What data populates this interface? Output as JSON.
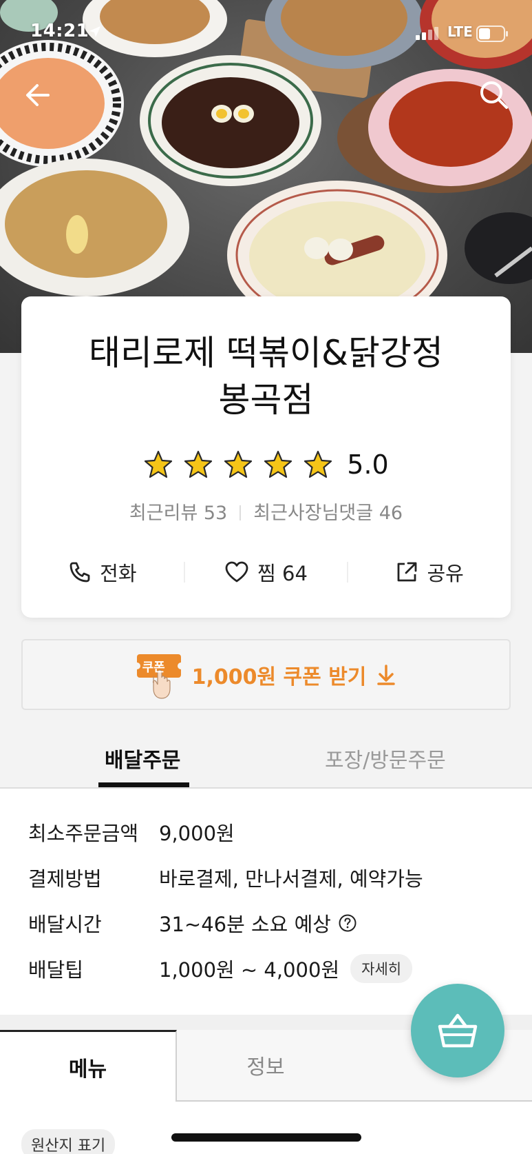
{
  "status_bar": {
    "time": "14:21",
    "network": "LTE"
  },
  "store": {
    "name_line1": "태리로제 떡볶이&닭강정",
    "name_line2": "봉곡점",
    "rating": "5.0",
    "stars": 5,
    "recent_reviews": "최근리뷰 53",
    "owner_replies": "최근사장님댓글 46"
  },
  "actions": {
    "call": "전화",
    "like": "찜 64",
    "share": "공유"
  },
  "coupon": {
    "badge": "쿠폰",
    "text": "1,000원 쿠폰 받기"
  },
  "order_tabs": {
    "delivery": "배달주문",
    "pickup": "포장/방문주문"
  },
  "delivery_info": {
    "min_order_label": "최소주문금액",
    "min_order_value": "9,000원",
    "payment_label": "결제방법",
    "payment_value": "바로결제, 만나서결제, 예약가능",
    "time_label": "배달시간",
    "time_value": "31~46분 소요 예상",
    "tip_label": "배달팁",
    "tip_value": "1,000원 ~ 4,000원",
    "tip_detail": "자세히"
  },
  "menu_tabs": {
    "menu": "메뉴",
    "info": "정보"
  },
  "origin_chip": "원산지 표기",
  "colors": {
    "accent_orange": "#ec8a2b",
    "cart_teal": "#5cbdb9",
    "star_gold": "#f5c518"
  }
}
